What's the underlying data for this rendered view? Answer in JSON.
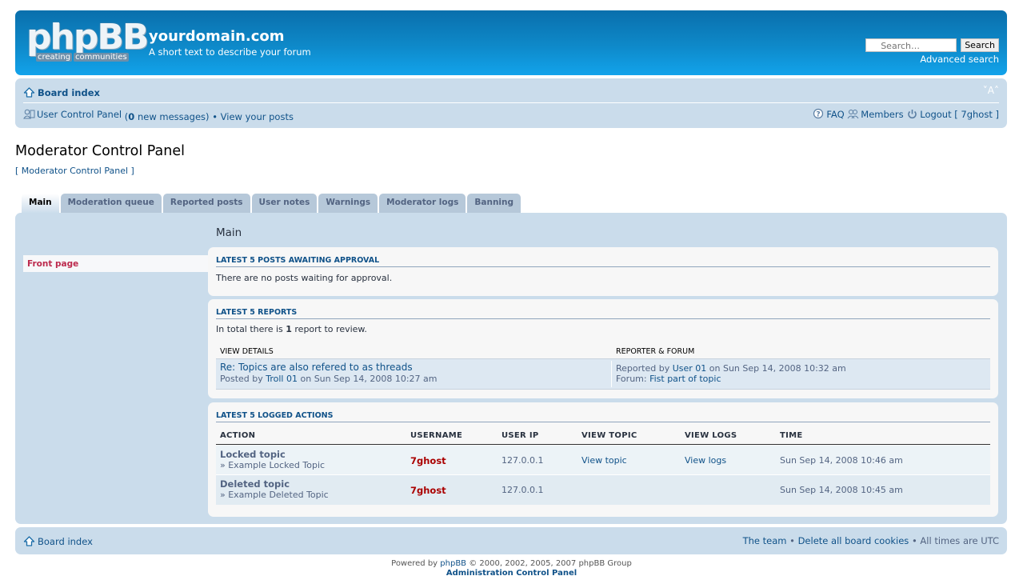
{
  "header": {
    "logo_main": "phpBB",
    "logo_tag": [
      "creating",
      "communities"
    ],
    "site_title": "yourdomain.com",
    "site_description": "A short text to describe your forum",
    "search_placeholder": "Search…",
    "search_button": "Search",
    "advanced_search": "Advanced search"
  },
  "navbar": {
    "board_index": "Board index",
    "font_size_control": "˅A˄",
    "ucp_link": "User Control Panel",
    "ucp_paren_open": " (",
    "new_messages_count": "0",
    "new_messages_text": " new messages)",
    "separator": " • ",
    "view_posts": "View your posts",
    "faq": "FAQ",
    "members": "Members",
    "logout": "Logout [ 7ghost ]"
  },
  "page": {
    "title": "Moderator Control Panel",
    "crumb": "[ Moderator Control Panel ]"
  },
  "tabs": [
    {
      "label": "Main",
      "active": true
    },
    {
      "label": "Moderation queue"
    },
    {
      "label": "Reported posts"
    },
    {
      "label": "User notes"
    },
    {
      "label": "Warnings"
    },
    {
      "label": "Moderator logs"
    },
    {
      "label": "Banning"
    }
  ],
  "sidebar": {
    "items": [
      {
        "label": "Front page",
        "active": true
      }
    ]
  },
  "main": {
    "heading": "Main",
    "approval": {
      "title": "Latest 5 posts awaiting approval",
      "message": "There are no posts waiting for approval."
    },
    "reports": {
      "title": "Latest 5 reports",
      "summary_pre": "In total there is ",
      "summary_count": "1",
      "summary_post": " report to review.",
      "col_details": "VIEW DETAILS",
      "col_reporter": "REPORTER & FORUM",
      "rows": [
        {
          "post_title": "Re: Topics are also refered to as threads",
          "posted_pre": "Posted by ",
          "posted_by": "Troll 01",
          "posted_on": " on Sun Sep 14, 2008 10:27 am",
          "reported_pre": "Reported by ",
          "reported_by": "User 01",
          "reported_on": " on Sun Sep 14, 2008 10:32 am",
          "forum_pre": "Forum: ",
          "forum": "Fist part of topic"
        }
      ]
    },
    "logs": {
      "title": "Latest 5 logged actions",
      "columns": [
        "ACTION",
        "USERNAME",
        "USER IP",
        "VIEW TOPIC",
        "VIEW LOGS",
        "TIME"
      ],
      "rows": [
        {
          "action": "Locked topic",
          "detail": "» Example Locked Topic",
          "username": "7ghost",
          "ip": "127.0.0.1",
          "view_topic": "View topic",
          "view_logs": "View logs",
          "time": "Sun Sep 14, 2008 10:46 am"
        },
        {
          "action": "Deleted topic",
          "detail": "» Example Deleted Topic",
          "username": "7ghost",
          "ip": "127.0.0.1",
          "view_topic": "",
          "view_logs": "",
          "time": "Sun Sep 14, 2008 10:45 am"
        }
      ]
    }
  },
  "footer": {
    "board_index": "Board index",
    "team": "The team",
    "sep": " • ",
    "delete_cookies": "Delete all board cookies",
    "timezone": "All times are UTC",
    "powered_pre": "Powered by ",
    "powered_link": "phpBB",
    "powered_post": " © 2000, 2002, 2005, 2007 phpBB Group",
    "acp": "Administration Control Panel"
  },
  "colors": {
    "header_gradient_top": "#0a6fac",
    "header_gradient_bottom": "#12a3eb",
    "panel_bg": "#cadceb",
    "link": "#105289",
    "active_menu": "#bc2a4d",
    "username": "#aa0000"
  }
}
